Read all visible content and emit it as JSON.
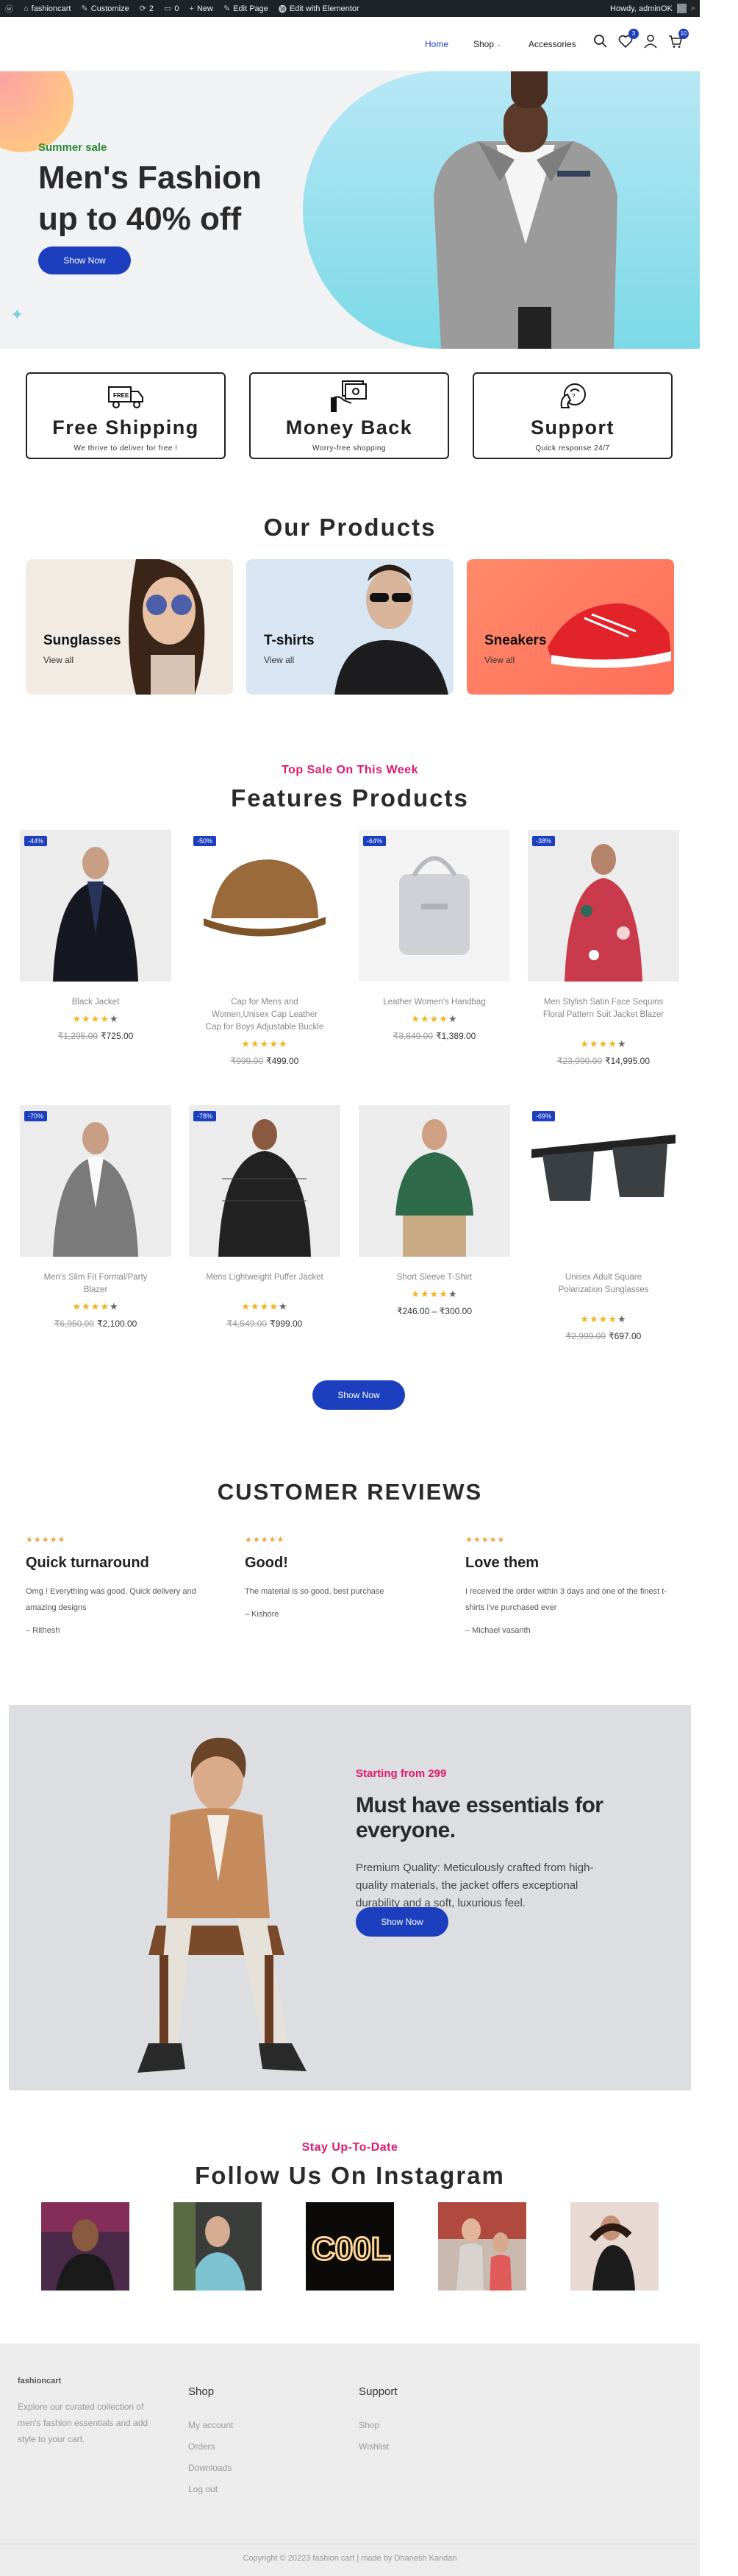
{
  "adminbar": {
    "site_name": "fashioncart",
    "customize": "Customize",
    "updates_count": "2",
    "comments_count": "0",
    "new": "New",
    "edit_page": "Edit Page",
    "edit_elementor": "Edit with Elementor",
    "howdy": "Howdy, adminOK"
  },
  "header": {
    "nav": [
      "Home",
      "Shop",
      "Accessories"
    ],
    "wishlist_count": "3",
    "cart_count": "10"
  },
  "hero": {
    "sale_label": "Summer sale",
    "title_line1": "Men's Fashion",
    "title_line2": "up to 40% off",
    "button": "Show Now"
  },
  "features": [
    {
      "icon": "truck-icon",
      "title": "Free Shipping",
      "subtitle": "We thrive to deliver for free !"
    },
    {
      "icon": "money-icon",
      "title": "Money Back",
      "subtitle": "Worry-free shopping"
    },
    {
      "icon": "support-icon",
      "title": "Support",
      "subtitle": "Quick response 24/7"
    }
  ],
  "our_products": {
    "title": "Our Products",
    "categories": [
      {
        "name": "Sunglasses",
        "link": "View all"
      },
      {
        "name": "T-shirts",
        "link": "View all"
      },
      {
        "name": "Sneakers",
        "link": "View all"
      }
    ]
  },
  "featured": {
    "eyebrow": "Top Sale On This Week",
    "title": "Features Products",
    "button": "Show Now",
    "products": [
      {
        "discount": "-44%",
        "name": "Black Jacket",
        "rating": 4,
        "old_price": "₹1,295.00",
        "price": "₹725.00"
      },
      {
        "discount": "-50%",
        "name": "Cap for Mens and Women,Unisex Cap Leather Cap for Boys Adjustable Buckle",
        "rating": 4.5,
        "old_price": "₹999.00",
        "price": "₹499.00"
      },
      {
        "discount": "-64%",
        "name": "Leather Women's Handbag",
        "rating": 4,
        "old_price": "₹3,849.00",
        "price": "₹1,389.00"
      },
      {
        "discount": "-38%",
        "name": "Men Stylish Satin Face Sequins Floral Pattern Suit Jacket Blazer",
        "rating": 4,
        "old_price": "₹23,990.00",
        "price": "₹14,995.00"
      },
      {
        "discount": "-70%",
        "name": "Men's Slim Fit Formal/Party Blazer",
        "rating": 4,
        "old_price": "₹6,950.00",
        "price": "₹2,100.00"
      },
      {
        "discount": "-78%",
        "name": "Mens Lightweight Puffer Jacket",
        "rating": 4,
        "old_price": "₹4,549.00",
        "price": "₹999.00"
      },
      {
        "discount": "",
        "name": "Short Sleeve T-Shirt",
        "rating": 4,
        "old_price": "",
        "price": "₹246.00 – ₹300.00"
      },
      {
        "discount": "-69%",
        "name": "Unisex Adult Square Polarization Sunglasses",
        "rating": 4,
        "old_price": "₹2,999.00",
        "price": "₹697.00"
      }
    ]
  },
  "reviews": {
    "title": "CUSTOMER REVIEWS",
    "items": [
      {
        "stars": "★★★★★",
        "title": "Quick turnaround",
        "body": "Omg ! Everything was good, Quick delivery and amazing designs",
        "author": "– Rithesh"
      },
      {
        "stars": "★★★★★",
        "title": "Good!",
        "body": "The material is so good, best purchase",
        "author": "– Kishore"
      },
      {
        "stars": "★★★★★",
        "title": "Love them",
        "body": "I received the order within 3 days and one of the finest t-shirts i've purchased ever",
        "author": "– Michael vasanth"
      }
    ]
  },
  "promo": {
    "eyebrow": "Starting from 299",
    "title": "Must have essentials for everyone.",
    "body": "Premium Quality: Meticulously crafted from high-quality materials, the jacket offers exceptional durability and a soft, luxurious feel.",
    "button": "Show Now"
  },
  "instagram": {
    "eyebrow": "Stay Up-To-Date",
    "title": "Follow Us On Instagram"
  },
  "footer": {
    "brand": "fashioncart",
    "about": "Explore our curated collection of men's fashion essentials and add style to your cart.",
    "shop_heading": "Shop",
    "shop_links": [
      "My account",
      "Orders",
      "Downloads",
      "Log out"
    ],
    "support_heading": "Support",
    "support_links": [
      "Shop",
      "Wishlist"
    ],
    "copyright": "Copyright © 20223 fashion cart | made by Dhanesh Kandan"
  },
  "colors": {
    "accent": "#1c3fbf",
    "pink": "#e0196f",
    "green": "#2a8a35",
    "star": "#f3b31b"
  }
}
